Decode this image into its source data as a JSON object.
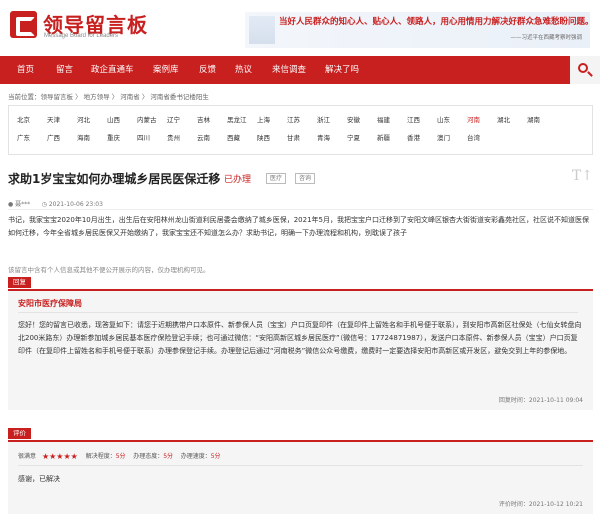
{
  "header": {
    "logo_cn": "领导留言板",
    "logo_en": "Message Board for Leaders",
    "slogan": "当好人民群众的知心人、贴心人、领路人，用心用情用力解决好群众急难愁盼问题。",
    "slogan_attribution": "——习近平在西藏考察时强调"
  },
  "nav": [
    "首页",
    "留言",
    "政企直通车",
    "案例库",
    "反馈",
    "热议",
    "来信调查",
    "解决了吗"
  ],
  "breadcrumb": [
    "当前位置：",
    "领导留言板",
    "地方领导",
    "河南省",
    "河南省委书记楼阳生"
  ],
  "regions": [
    [
      "北京",
      "天津",
      "河北",
      "山西",
      "内蒙古",
      "辽宁",
      "吉林",
      "黑龙江",
      "上海",
      "江苏",
      "浙江",
      "安徽",
      "福建",
      "江西",
      "山东",
      "河南",
      "湖北",
      "湖南"
    ],
    [
      "广东",
      "广西",
      "海南",
      "重庆",
      "四川",
      "贵州",
      "云南",
      "西藏",
      "陕西",
      "甘肃",
      "青海",
      "宁夏",
      "新疆",
      "香港",
      "澳门",
      "台湾"
    ]
  ],
  "message": {
    "title": "求助1岁宝宝如何办理城乡居民医保迁移",
    "status": "已办理",
    "tags": [
      "医疗",
      "咨询"
    ],
    "author": "聂***",
    "time": "2021-10-06 23:03",
    "body": "书记，我家宝宝2020年10月出生，出生后在安阳林州龙山街道利民居委会缴纳了城乡医保，2021年5月，我把宝宝户口迁移到了安阳文峰区银杏大街街道安彩鑫苑社区，社区说不知道医保如何迁移，今年全省城乡居民医保又开始缴纳了，我家宝宝还不知道怎么办？求助书记，明确一下办理流程和机构，别耽误了孩子",
    "notice": "该留言中含有个人信息或其他不便公开展示的内容，仅办理机构可见。"
  },
  "reply": {
    "label": "回复",
    "org": "安阳市医疗保障局",
    "text": "您好！您的留言已收悉，现答复如下：请您于近期携带户口本原件、新参保人员（宝宝）户口页复印件（在复印件上留姓名和手机号便于联系），到安阳市高新区社保处（七仙女转盘向北200米路东）办理新参加城乡居民基本医疗保险登记手续；也可通过微信：“安阳高新区城乡居民医疗”（微信号：17724871987），发送户口本原件、新参保人员（宝宝）户口页复印件（在复印件上留姓名和手机号便于联系）办理参保登记手续。办理登记后通过“河南税务”微信公众号缴费，缴费时一定要选择安阳市高新区或开发区，避免交到上年的参保地。",
    "time": "回复时间：2021-10-11 09:04"
  },
  "rating": {
    "label": "评价",
    "satisfaction_label": "很满意",
    "stars": 5,
    "items": [
      {
        "name": "解决程度：",
        "score": "5分"
      },
      {
        "name": "办理态度：",
        "score": "5分"
      },
      {
        "name": "办理速度：",
        "score": "5分"
      }
    ],
    "text": "感谢，已解决",
    "time": "评价时间：2021-10-12 10:21"
  },
  "colors": {
    "accent": "#c81f1f",
    "panel": "#f5f5f5"
  }
}
